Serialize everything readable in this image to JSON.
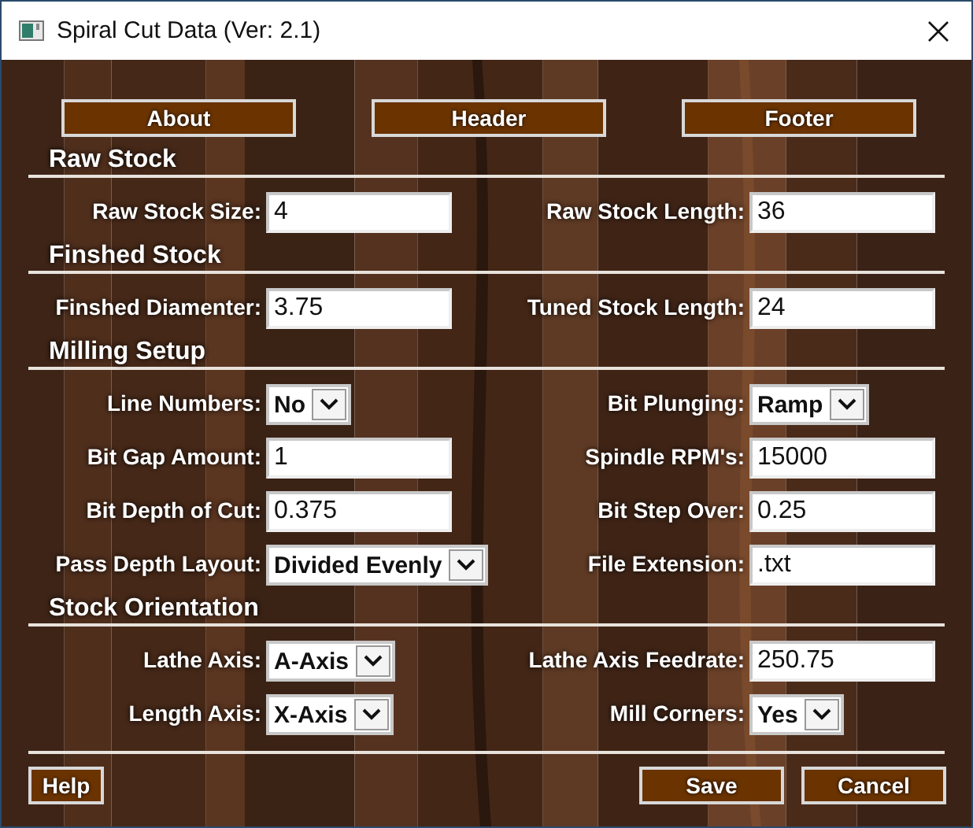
{
  "window": {
    "title": "Spiral Cut Data (Ver: 2.1)"
  },
  "top_buttons": [
    "About",
    "Header",
    "Footer"
  ],
  "sections": [
    {
      "title": "Raw Stock",
      "rows": [
        {
          "left": {
            "label": "Raw Stock Size:",
            "kind": "text",
            "value": "4"
          },
          "right": {
            "label": "Raw Stock Length:",
            "kind": "text",
            "value": "36"
          }
        }
      ]
    },
    {
      "title": "Finshed Stock",
      "rows": [
        {
          "left": {
            "label": "Finshed Diamenter:",
            "kind": "text",
            "value": "3.75"
          },
          "right": {
            "label": "Tuned Stock Length:",
            "kind": "text",
            "value": "24"
          }
        }
      ]
    },
    {
      "title": "Milling Setup",
      "rows": [
        {
          "left": {
            "label": "Line Numbers:",
            "kind": "select",
            "value": "No"
          },
          "right": {
            "label": "Bit Plunging:",
            "kind": "select",
            "value": "Ramp"
          }
        },
        {
          "left": {
            "label": "Bit Gap Amount:",
            "kind": "text",
            "value": "1"
          },
          "right": {
            "label": "Spindle RPM's:",
            "kind": "text",
            "value": "15000"
          }
        },
        {
          "left": {
            "label": "Bit Depth of Cut:",
            "kind": "text",
            "value": "0.375"
          },
          "right": {
            "label": "Bit Step Over:",
            "kind": "text",
            "value": "0.25"
          }
        },
        {
          "left": {
            "label": "Pass Depth Layout:",
            "kind": "select",
            "value": "Divided Evenly"
          },
          "right": {
            "label": "File Extension:",
            "kind": "text",
            "value": ".txt"
          }
        }
      ]
    },
    {
      "title": "Stock Orientation",
      "rows": [
        {
          "left": {
            "label": "Lathe Axis:",
            "kind": "select",
            "value": "A-Axis"
          },
          "right": {
            "label": "Lathe Axis Feedrate:",
            "kind": "text",
            "value": "250.75"
          }
        },
        {
          "left": {
            "label": "Length Axis:",
            "kind": "select",
            "value": "X-Axis"
          },
          "right": {
            "label": "Mill Corners:",
            "kind": "select",
            "value": "Yes"
          }
        }
      ]
    }
  ],
  "bottom_left_buttons": [
    "Help"
  ],
  "bottom_right_buttons": [
    "Save",
    "Cancel"
  ]
}
